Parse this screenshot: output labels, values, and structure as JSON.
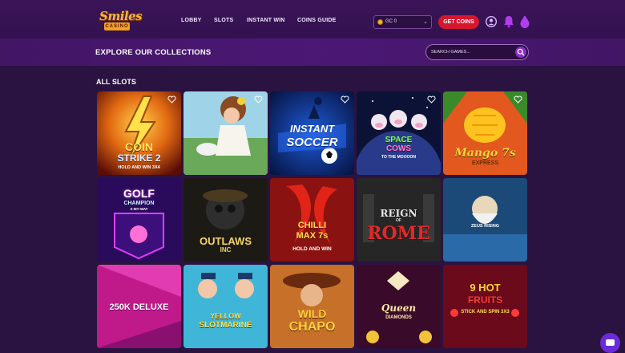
{
  "brand": {
    "logo_text": "Smiles",
    "logo_sub": "CASINO"
  },
  "nav": {
    "items": [
      {
        "label": "LOBBY"
      },
      {
        "label": "SLOTS"
      },
      {
        "label": "INSTANT WIN"
      },
      {
        "label": "COINS GUIDE"
      }
    ]
  },
  "wallet": {
    "selected": "GC 0"
  },
  "get_coins_label": "GET COINS",
  "collections": {
    "title": "EXPLORE OUR COLLECTIONS",
    "search_placeholder": "SEARCH GAMES..."
  },
  "section_title": "ALL SLOTS",
  "games": [
    {
      "title_line1": "COIN",
      "title_line2": "STRIKE 2",
      "title_line3": "HOLD AND WIN 3X4"
    },
    {
      "title_line1": "",
      "title_line2": "",
      "title_line3": ""
    },
    {
      "title_line1": "INSTANT",
      "title_line2": "SOCCER",
      "title_line3": ""
    },
    {
      "title_line1": "SPACE",
      "title_line2": "COWS",
      "title_line3": "TO THE MOOOON"
    },
    {
      "title_line1": "Mango 7s",
      "title_line2": "EXPRESS",
      "title_line3": ""
    },
    {
      "title_line1": "GOLF",
      "title_line2": "CHAMPION",
      "title_line3": "X-MY-WAY"
    },
    {
      "title_line1": "OUTLAWS",
      "title_line2": "INC",
      "title_line3": ""
    },
    {
      "title_line1": "CHILLI",
      "title_line2": "MAX 7s",
      "title_line3": "HOLD AND WIN"
    },
    {
      "title_line1": "REIGN",
      "title_line2": "OF",
      "title_line3": "ROME"
    },
    {
      "title_line1": "ZEUS RISING",
      "title_line2": "",
      "title_line3": ""
    },
    {
      "title_line1": "250K DELUXE",
      "title_line2": "",
      "title_line3": ""
    },
    {
      "title_line1": "YELLOW",
      "title_line2": "SLOTMARINE",
      "title_line3": ""
    },
    {
      "title_line1": "WILD",
      "title_line2": "CHAPO",
      "title_line3": ""
    },
    {
      "title_line1": "Queen",
      "title_line2": "DIAMONDS",
      "title_line3": ""
    },
    {
      "title_line1": "9 HOT",
      "title_line2": "FRUITS",
      "title_line3": "STICK AND SPIN 3X3"
    }
  ],
  "colors": {
    "accent": "#d4172d",
    "background": "#2a1340",
    "nav_bg": "#3a1457",
    "search_button": "#8b2fc9",
    "chat_bubble": "#6a2bd8"
  },
  "icons": {
    "user": "user-circle-icon",
    "bell": "bell-icon",
    "drop": "droplet-icon",
    "search": "search-icon",
    "fav": "heart-icon",
    "chat": "chat-icon"
  }
}
